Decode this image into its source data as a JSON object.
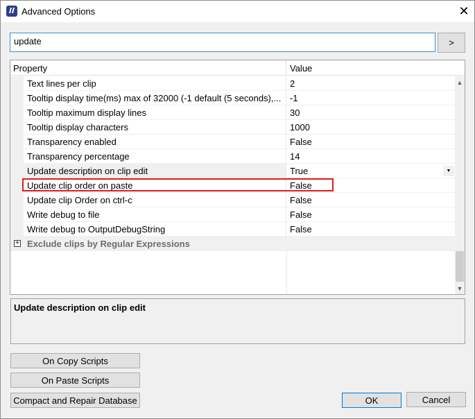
{
  "window": {
    "title": "Advanced Options",
    "close_glyph": "✕"
  },
  "search": {
    "value": "update",
    "go_label": ">"
  },
  "grid": {
    "headers": {
      "property": "Property",
      "value": "Value"
    },
    "rows": [
      {
        "name": "Text lines per clip",
        "value": "2"
      },
      {
        "name": "Tooltip display time(ms) max of 32000 (-1 default (5 seconds),...",
        "value": "-1"
      },
      {
        "name": "Tooltip maximum display lines",
        "value": "30"
      },
      {
        "name": "Tooltip display characters",
        "value": "1000"
      },
      {
        "name": "Transparency enabled",
        "value": "False"
      },
      {
        "name": "Transparency percentage",
        "value": "14"
      },
      {
        "name": "Update description on clip edit",
        "value": "True",
        "selected": true,
        "has_dropdown": true
      },
      {
        "name": "Update clip order on paste",
        "value": "False",
        "highlighted": true
      },
      {
        "name": "Update clip Order on ctrl-c",
        "value": "False"
      },
      {
        "name": "Write debug to file",
        "value": "False"
      },
      {
        "name": "Write debug to OutputDebugString",
        "value": "False"
      }
    ],
    "category": {
      "label": "Exclude clips by Regular Expressions",
      "expander": "+"
    },
    "dropdown_glyph": "▼",
    "scroll_up_glyph": "▲",
    "scroll_down_glyph": "▼",
    "highlight_color": "#e21b1b"
  },
  "description": {
    "text": "Update description on clip edit"
  },
  "buttons": {
    "on_copy_scripts": "On Copy Scripts",
    "on_paste_scripts": "On Paste Scripts",
    "compact_repair": "Compact and Repair Database",
    "ok": "OK",
    "cancel": "Cancel"
  }
}
